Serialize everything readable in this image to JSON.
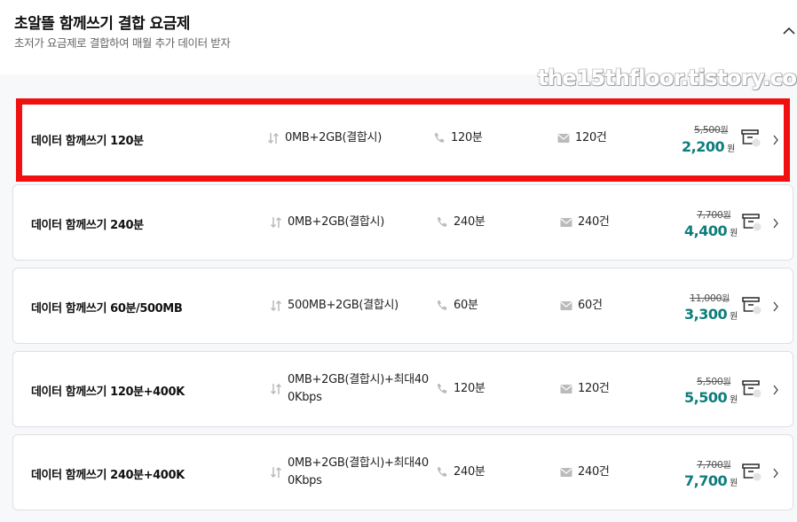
{
  "header": {
    "title": "초알뜰 함께쓰기 결합 요금제",
    "subtitle": "초저가 요금제로 결합하여 매월 추가 데이터 받자"
  },
  "watermark": "the15thfloor.tistory.com",
  "plans": [
    {
      "name": "데이터 함께쓰기 120분",
      "data": "0MB+2GB(결합시)",
      "call": "120분",
      "sms": "120건",
      "original_price": "5,500",
      "price": "2,200",
      "won": "원"
    },
    {
      "name": "데이터 함께쓰기 240분",
      "data": "0MB+2GB(결합시)",
      "call": "240분",
      "sms": "240건",
      "original_price": "7,700",
      "price": "4,400",
      "won": "원"
    },
    {
      "name": "데이터 함께쓰기 60분/500MB",
      "data": "500MB+2GB(결합시)",
      "call": "60분",
      "sms": "60건",
      "original_price": "11,000",
      "price": "3,300",
      "won": "원"
    },
    {
      "name": "데이터 함께쓰기 120분+400K",
      "data": "0MB+2GB(결합시)+최대400Kbps",
      "call": "120분",
      "sms": "120건",
      "original_price": "5,500",
      "price": "5,500",
      "won": "원"
    },
    {
      "name": "데이터 함께쓰기 240분+400K",
      "data": "0MB+2GB(결합시)+최대400Kbps",
      "call": "240분",
      "sms": "240건",
      "original_price": "7,700",
      "price": "7,700",
      "won": "원"
    }
  ],
  "colors": {
    "accent": "#0e7d7c",
    "highlight": "#f01010"
  }
}
